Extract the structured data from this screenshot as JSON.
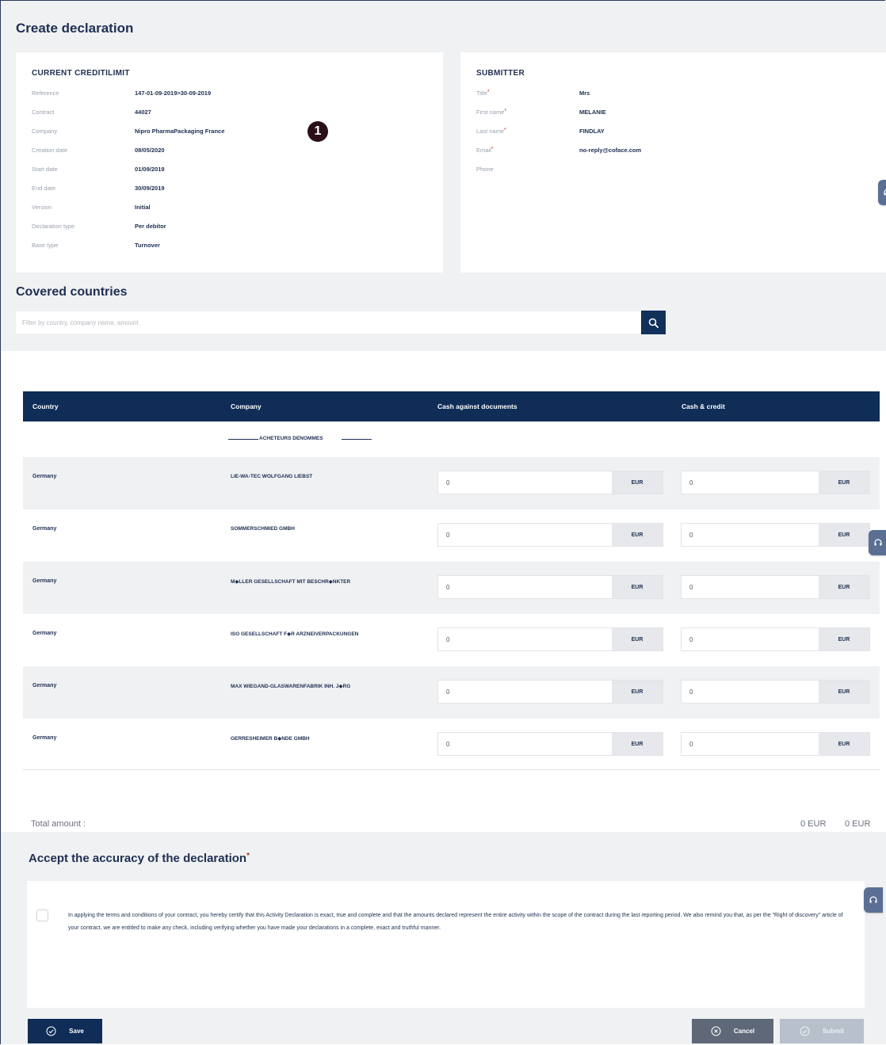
{
  "page": {
    "title": "Create declaration"
  },
  "credit_limit": {
    "title": "CURRENT CREDITILIMIT",
    "rows": [
      {
        "label": "Reference",
        "value": "147-01-09-2019>30-09-2019"
      },
      {
        "label": "Contract",
        "value": "44027"
      },
      {
        "label": "Company",
        "value": "Nipro PharmaPackaging France"
      },
      {
        "label": "Creation date",
        "value": "08/05/2020"
      },
      {
        "label": "Start date",
        "value": "01/09/2019"
      },
      {
        "label": "End date",
        "value": "30/09/2019"
      },
      {
        "label": "Version",
        "value": "Initial"
      },
      {
        "label": "Declaration type",
        "value": "Per debitor"
      },
      {
        "label": "Base type",
        "value": "Turnover"
      }
    ],
    "callout": "1"
  },
  "submitter": {
    "title": "SUBMITTER",
    "rows": [
      {
        "label": "Title",
        "required": "*",
        "value": "Mrs"
      },
      {
        "label": "First name",
        "required": "*",
        "value": "MELANIE"
      },
      {
        "label": "Last name",
        "required": "*",
        "value": "FINDLAY"
      },
      {
        "label": "Email",
        "required": "*",
        "value": "no-reply@coface.com"
      },
      {
        "label": "Phone",
        "required": "",
        "value": ""
      }
    ]
  },
  "covered": {
    "title": "Covered countries",
    "filter_placeholder": "Filter by country, company name, amount",
    "filter_value": ""
  },
  "table": {
    "headers": {
      "country": "Country",
      "company": "Company",
      "cad": "Cash against documents",
      "cash_credit": "Cash & credit"
    },
    "group_label": "ACHETEURS DENOMMES",
    "rows": [
      {
        "country": "Germany",
        "company": "LIE-WA-TEC WOLFGANG LIEBST",
        "cad_value": "0",
        "cad_currency": "EUR",
        "cc_value": "0",
        "cc_currency": "EUR"
      },
      {
        "country": "Germany",
        "company": "SOMMERSCHMIED GMBH",
        "cad_value": "0",
        "cad_currency": "EUR",
        "cc_value": "0",
        "cc_currency": "EUR"
      },
      {
        "country": "Germany",
        "company": "M◆LLER GESELLSCHAFT MIT BESCHR◆NKTER",
        "cad_value": "0",
        "cad_currency": "EUR",
        "cc_value": "0",
        "cc_currency": "EUR"
      },
      {
        "country": "Germany",
        "company": "ISO GESELLSCHAFT F◆R ARZNEIVERPACKUNGEN",
        "cad_value": "0",
        "cad_currency": "EUR",
        "cc_value": "0",
        "cc_currency": "EUR"
      },
      {
        "country": "Germany",
        "company": "MAX WIEGAND-GLASWARENFABRIK INH. J◆RG",
        "cad_value": "0",
        "cad_currency": "EUR",
        "cc_value": "0",
        "cc_currency": "EUR"
      },
      {
        "country": "Germany",
        "company": "GERRESHEIMER B◆NDE GMBH",
        "cad_value": "0",
        "cad_currency": "EUR",
        "cc_value": "0",
        "cc_currency": "EUR"
      }
    ]
  },
  "totals": {
    "label": "Total amount :",
    "cad_total": "0 EUR",
    "cc_total": "0 EUR"
  },
  "accept": {
    "title": "Accept the accuracy of the declaration",
    "required": "*",
    "text": "In applying the terms and conditions of your contract, you hereby certify that this Activity Declaration is exact, true and complete and that the amounts declared represent the entire activity within the scope of the contract during the last reporting period. We also remind you that, as per the \"Right of discovery\" article of your contract, we are entitled to make any check, including verifying whether you have made your declarations in a complete, exact and truthful manner.",
    "checked": false
  },
  "actions": {
    "save": "Save",
    "cancel": "Cancel",
    "submit": "Submit"
  },
  "icons": {
    "search": "search-icon",
    "save": "check-circle-icon",
    "cancel": "close-circle-icon",
    "submit": "check-circle-icon",
    "side": "headset-icon"
  },
  "colors": {
    "primary": "#0f2d57",
    "required": "#c42a2a",
    "panel": "#f0f1f3",
    "cancel": "#5e6878",
    "submit_disabled": "#b8c0cc"
  }
}
